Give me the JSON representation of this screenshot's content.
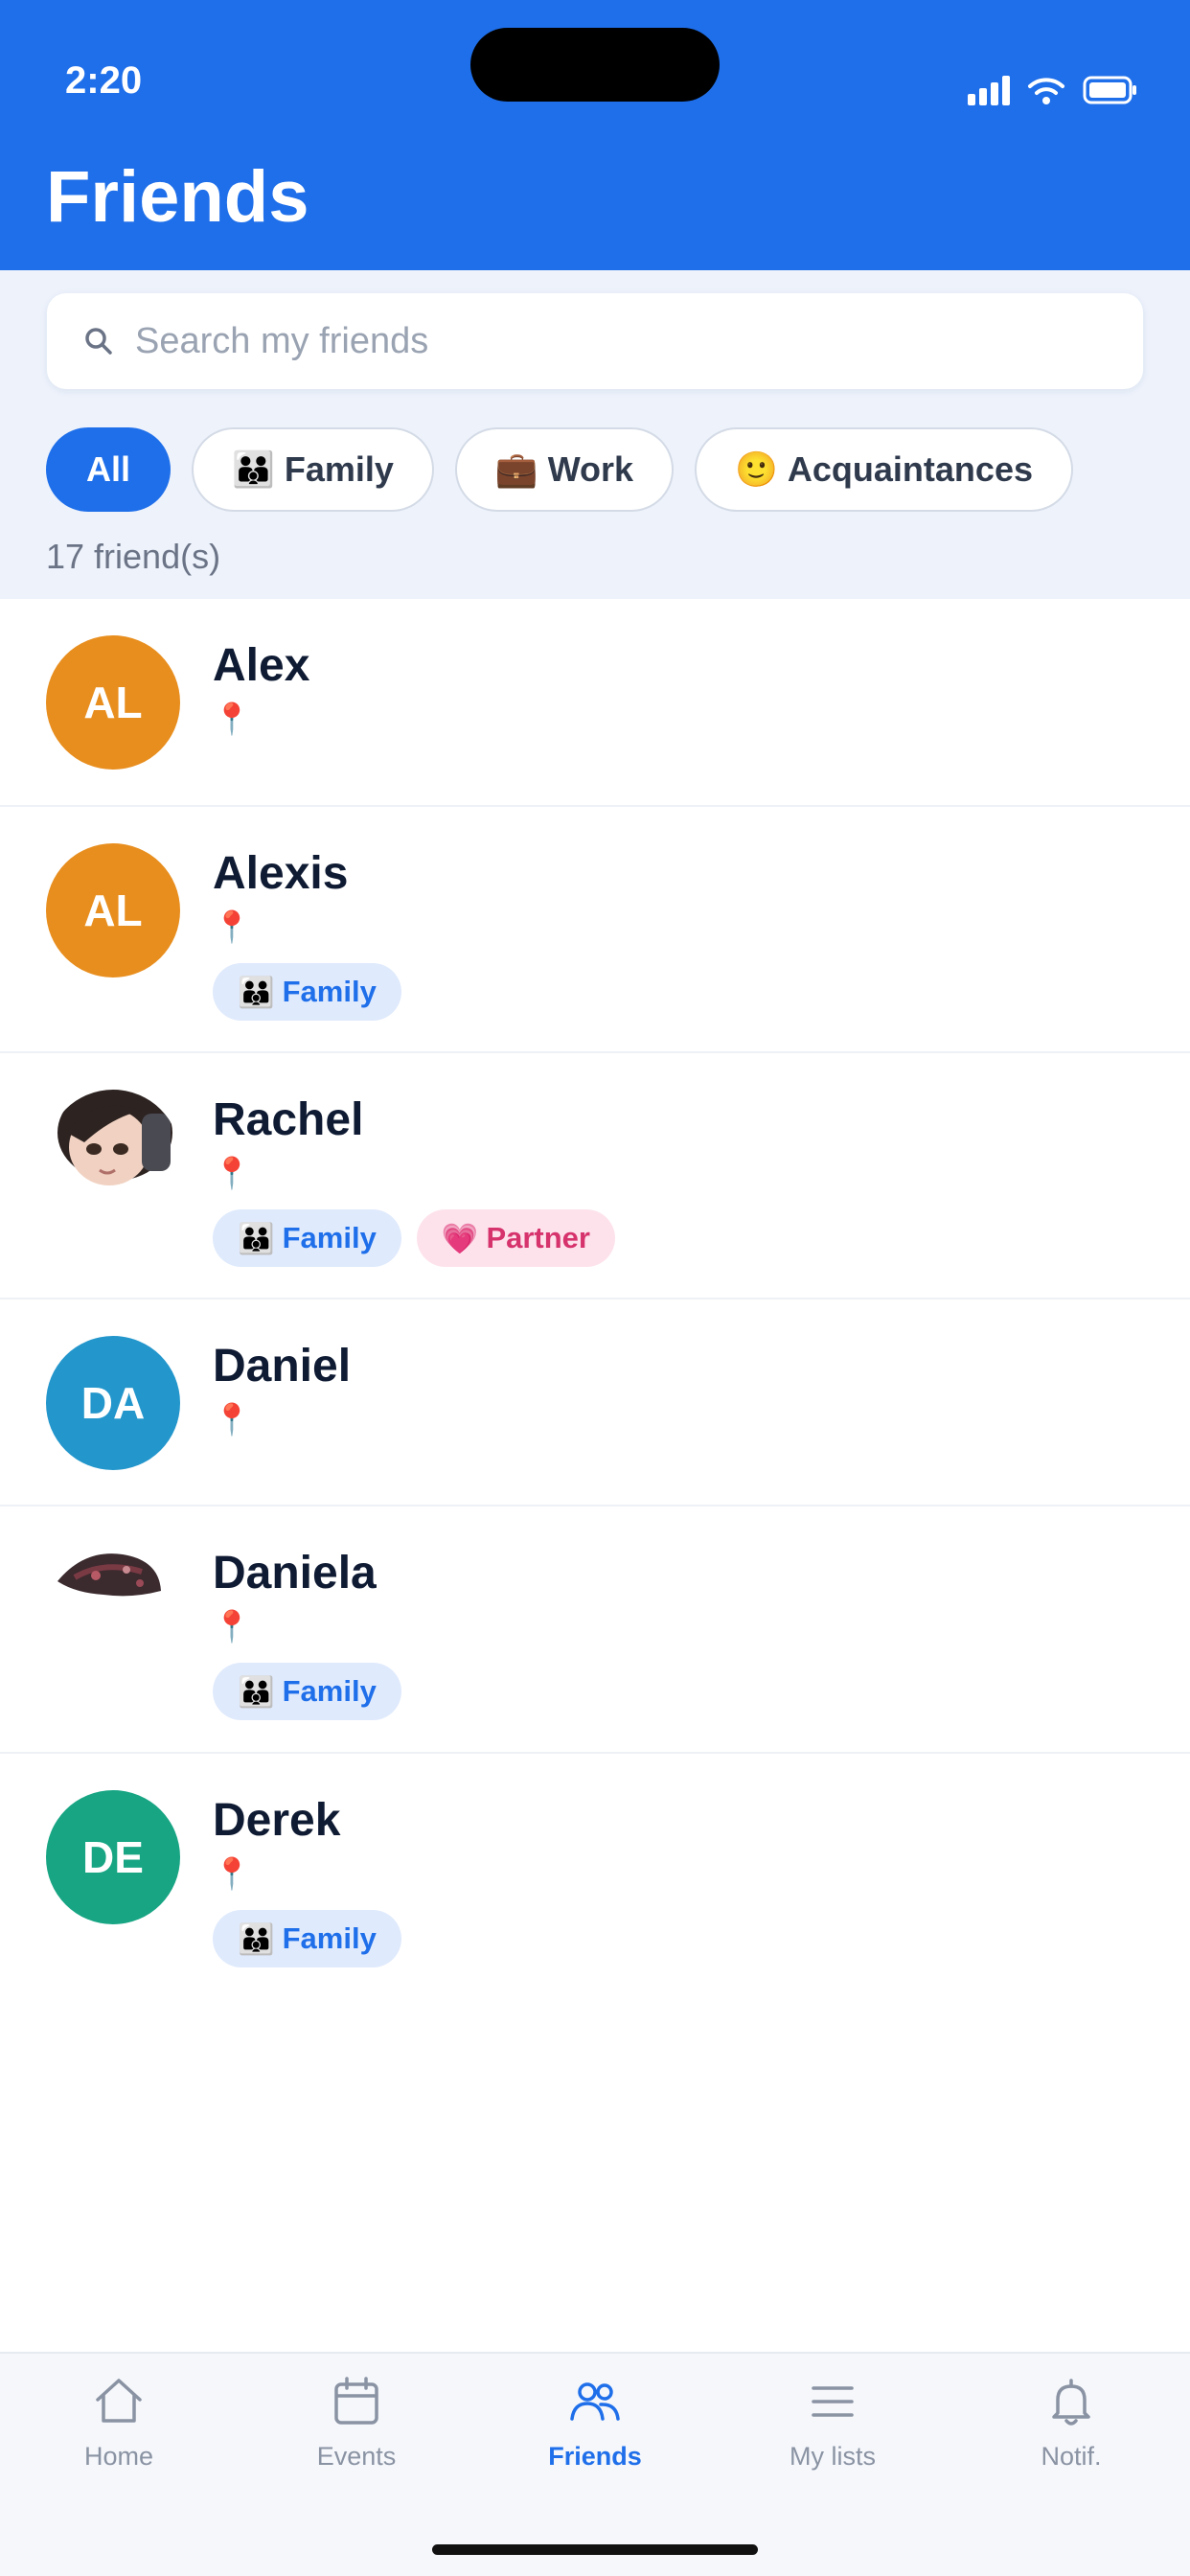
{
  "status_bar": {
    "time": "2:20"
  },
  "header": {
    "title": "Friends"
  },
  "search": {
    "placeholder": "Search my friends"
  },
  "filters": [
    {
      "label": "All",
      "emoji": "",
      "active": true
    },
    {
      "label": "Family",
      "emoji": "👪",
      "active": false
    },
    {
      "label": "Work",
      "emoji": "💼",
      "active": false
    },
    {
      "label": "Acquaintances",
      "emoji": "🙂",
      "active": false
    }
  ],
  "friend_count": "17 friend(s)",
  "pin_icon": "📍",
  "friends": [
    {
      "name": "Alex",
      "initials": "AL",
      "avatar_color": "#e88e1e",
      "photo": false,
      "tags": []
    },
    {
      "name": "Alexis",
      "initials": "AL",
      "avatar_color": "#e88e1e",
      "photo": false,
      "tags": [
        {
          "emoji": "👪",
          "label": "Family",
          "kind": "family"
        }
      ]
    },
    {
      "name": "Rachel",
      "initials": "",
      "avatar_color": "#ffffff",
      "photo": true,
      "tags": [
        {
          "emoji": "👪",
          "label": "Family",
          "kind": "family"
        },
        {
          "emoji": "💗",
          "label": "Partner",
          "kind": "partner"
        }
      ]
    },
    {
      "name": "Daniel",
      "initials": "DA",
      "avatar_color": "#2396cc",
      "photo": false,
      "tags": []
    },
    {
      "name": "Daniela",
      "initials": "",
      "avatar_color": "#ffffff",
      "photo": true,
      "tags": [
        {
          "emoji": "👪",
          "label": "Family",
          "kind": "family"
        }
      ]
    },
    {
      "name": "Derek",
      "initials": "DE",
      "avatar_color": "#17a583",
      "photo": false,
      "tags": [
        {
          "emoji": "👪",
          "label": "Family",
          "kind": "family"
        }
      ]
    }
  ],
  "nav": [
    {
      "label": "Home",
      "icon": "home-icon",
      "active": false
    },
    {
      "label": "Events",
      "icon": "calendar-icon",
      "active": false
    },
    {
      "label": "Friends",
      "icon": "people-icon",
      "active": true
    },
    {
      "label": "My lists",
      "icon": "list-icon",
      "active": false
    },
    {
      "label": "Notif.",
      "icon": "bell-icon",
      "active": false
    }
  ],
  "colors": {
    "primary": "#1f6fea",
    "filter_bg": "#edf2fb"
  }
}
